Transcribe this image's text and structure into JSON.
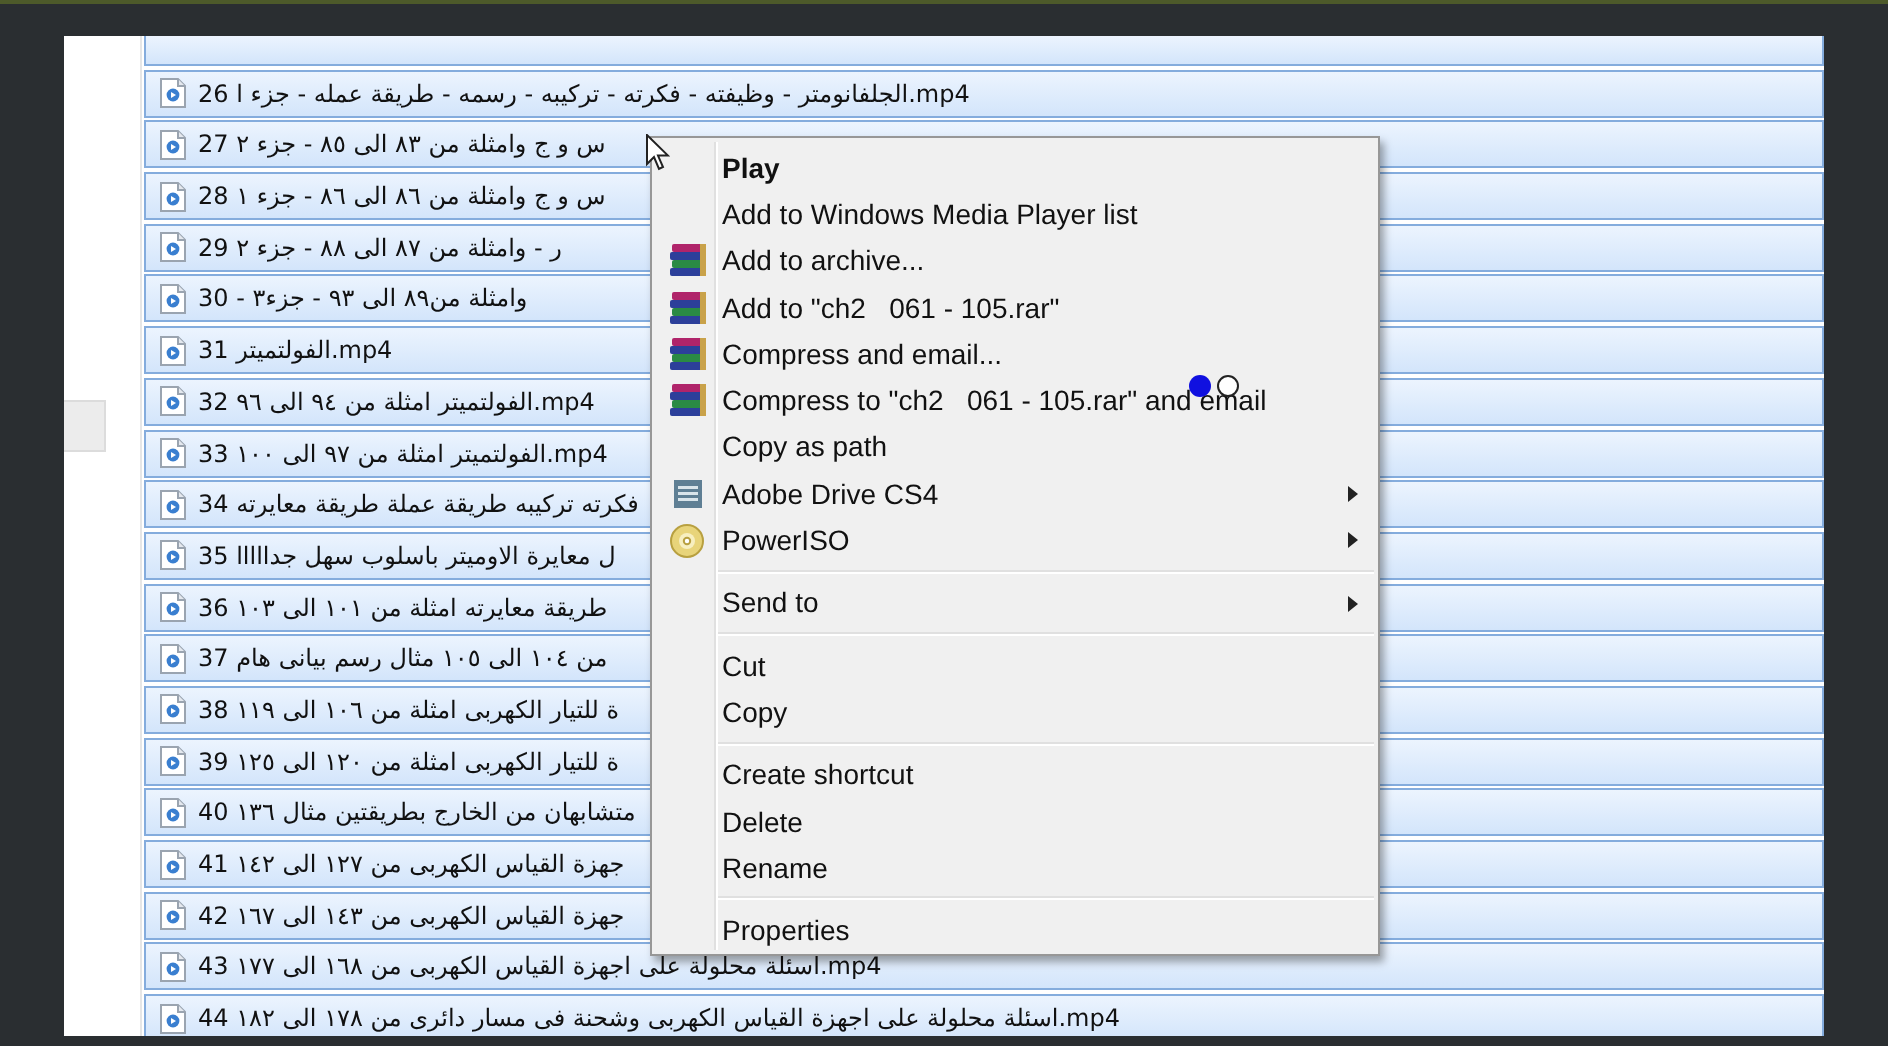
{
  "file_list": {
    "rows": [
      {
        "name": "26 الجلفانومتر - وظيفته - فكرته - تركيبه - رسمه - طريقة عمله - جزء ا.mp4",
        "selected": true
      },
      {
        "name": "27 س و ج وامثلة من ٨٣ الى ٨٥ - جزء ٢",
        "selected": true
      },
      {
        "name": "28 س و ج وامثلة من ٨٦ الى ٨٦ - جزء ١",
        "selected": true
      },
      {
        "name": "29 ر - وامثلة من ٨٧ الى ٨٨ - جزء ٢",
        "selected": true
      },
      {
        "name": "30 - وامثلة من٨٩ الى ٩٣ - جزء٣",
        "selected": true
      },
      {
        "name": "31 الفولتميتر.mp4",
        "selected": true
      },
      {
        "name": "32 الفولتميتر امثلة من ٩٤ الى ٩٦.mp4",
        "selected": true
      },
      {
        "name": "33 الفولتميتر امثلة من ٩٧ الى ١٠٠.mp4",
        "selected": true
      },
      {
        "name": "34 فكرته تركيبه طريقة عملة طريقة معايرته",
        "selected": true
      },
      {
        "name": "35 ل معايرة الاوميتر باسلوب سهل جدااااا",
        "selected": true
      },
      {
        "name": "36 طريقة معايرته امثلة من ١٠١ الى ١٠٣",
        "selected": true
      },
      {
        "name": "37 من ١٠٤ الى ١٠٥ مثال رسم بيانى هام",
        "selected": true
      },
      {
        "name": "38 ة للتيار الكهربى امثلة من ١٠٦ الى ١١٩",
        "selected": true
      },
      {
        "name": "39 ة للتيار الكهربى امثلة من ١٢٠ الى ١٢٥",
        "selected": true
      },
      {
        "name": "40 متشابهان من الخارج بطريقتين مثال ١٣٦",
        "selected": true
      },
      {
        "name": "41 جهزة القياس الكهربى من ١٢٧ الى ١٤٢",
        "selected": true
      },
      {
        "name": "42 جهزة القياس الكهربى من ١٤٣ الى ١٦٧",
        "selected": true
      },
      {
        "name": "43 اسئلة محلولة على اجهزة القياس الكهربى من ١٦٨ الى ١٧٧.mp4",
        "selected": true
      },
      {
        "name": "44 اسئلة محلولة على اجهزة القياس الكهربى وشحنة فى مسار دائرى من ١٧٨ الى ١٨٢.mp4",
        "selected": true
      }
    ]
  },
  "context_menu": {
    "items": [
      {
        "kind": "plain",
        "label": "Play",
        "default": true,
        "submenu": false
      },
      {
        "kind": "plain",
        "label": "Add to Windows Media Player list",
        "default": false,
        "submenu": false
      },
      {
        "kind": "archive",
        "label": "Add to archive...",
        "default": false,
        "submenu": false
      },
      {
        "kind": "archive",
        "label": "Add to \"ch2   061 - 105.rar\"",
        "default": false,
        "submenu": false
      },
      {
        "kind": "archive",
        "label": "Compress and email...",
        "default": false,
        "submenu": false
      },
      {
        "kind": "archive",
        "label": "Compress to \"ch2   061 - 105.rar\" and email",
        "default": false,
        "submenu": false
      },
      {
        "kind": "plain",
        "label": "Copy as path",
        "default": false,
        "submenu": false
      },
      {
        "kind": "drive",
        "label": "Adobe Drive CS4",
        "default": false,
        "submenu": true
      },
      {
        "kind": "disc",
        "label": "PowerISO",
        "default": false,
        "submenu": true
      },
      {
        "kind": "separator"
      },
      {
        "kind": "plain",
        "label": "Send to",
        "default": false,
        "submenu": true
      },
      {
        "kind": "separator"
      },
      {
        "kind": "plain",
        "label": "Cut",
        "default": false,
        "submenu": false
      },
      {
        "kind": "plain",
        "label": "Copy",
        "default": false,
        "submenu": false
      },
      {
        "kind": "separator"
      },
      {
        "kind": "plain",
        "label": "Create shortcut",
        "default": false,
        "submenu": false
      },
      {
        "kind": "plain",
        "label": "Delete",
        "default": false,
        "submenu": false
      },
      {
        "kind": "plain",
        "label": "Rename",
        "default": false,
        "submenu": false
      },
      {
        "kind": "separator"
      },
      {
        "kind": "plain",
        "label": "Properties",
        "default": false,
        "submenu": false
      }
    ]
  }
}
